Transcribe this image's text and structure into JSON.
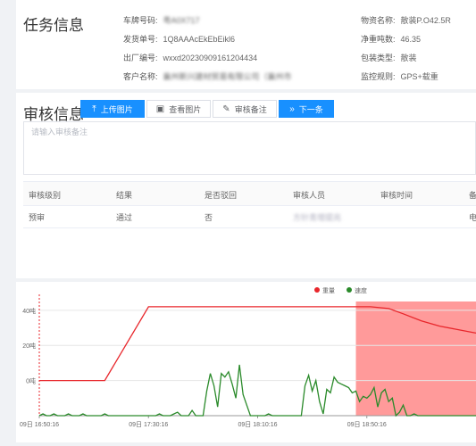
{
  "task": {
    "title": "任务信息",
    "fields": [
      {
        "label": "车牌号码:",
        "value": "粤A0X717",
        "blurred": true
      },
      {
        "label": "发货单号:",
        "value": "1Q8AAAcEkEbEikl6",
        "blurred": false
      },
      {
        "label": "出厂编号:",
        "value": "wxxd20230909161204434",
        "blurred": false
      },
      {
        "label": "客户名称:",
        "value": "襄州新兴建材贸易有限公司（襄州市",
        "blurred": true
      },
      {
        "label": "物资名称:",
        "value": "散装P.O42.5R",
        "blurred": false
      },
      {
        "label": "净重吨数:",
        "value": "46.35",
        "blurred": false
      },
      {
        "label": "包装类型:",
        "value": "散装",
        "blurred": false
      },
      {
        "label": "监控规则:",
        "value": "GPS+载重",
        "blurred": false
      }
    ]
  },
  "audit": {
    "title": "审核信息",
    "buttons": {
      "upload": "上传图片",
      "view": "查看图片",
      "remark": "审核备注",
      "next": "下一条"
    },
    "remark_placeholder": "请输入审核备注",
    "table": {
      "headers": [
        "审核级别",
        "结果",
        "是否驳回",
        "审核人员",
        "审核时间",
        "备"
      ],
      "rows": [
        [
          "预审",
          "通过",
          "否",
          "方针青增提兆",
          "",
          "电"
        ]
      ]
    }
  },
  "chart_data": {
    "type": "line",
    "legend": [
      "重量",
      "速度"
    ],
    "series_colors": [
      "#e8262b",
      "#2a8a2a"
    ],
    "highlight_color": "#ff9a9a",
    "y_ticks": [
      "40吨",
      "20吨",
      "0吨"
    ],
    "x_ticks": [
      "09日 16:50:16",
      "09日 17:30:16",
      "09日 18:10:16",
      "09日 18:50:16"
    ],
    "ylim": [
      -20,
      45
    ],
    "x_range": [
      0,
      120
    ],
    "marker_x": 0,
    "highlight_range": [
      87,
      120
    ],
    "weight": {
      "x": [
        0,
        18,
        30,
        31,
        87,
        91,
        96,
        100,
        105,
        110,
        115,
        120
      ],
      "y": [
        0,
        0,
        42,
        42,
        42,
        42,
        41,
        38,
        34,
        31,
        29,
        27
      ]
    },
    "speed": {
      "x": [
        0,
        1,
        2,
        3,
        4,
        5,
        6,
        7,
        8,
        9,
        10,
        11,
        12,
        13,
        14,
        15,
        16,
        17,
        18,
        19,
        20,
        21,
        22,
        23,
        24,
        25,
        26,
        27,
        28,
        29,
        30,
        31,
        32,
        33,
        34,
        35,
        36,
        37,
        38,
        39,
        40,
        41,
        42,
        43,
        44,
        45,
        46,
        47,
        48,
        49,
        50,
        51,
        52,
        53,
        54,
        55,
        56,
        57,
        58,
        59,
        60,
        61,
        62,
        63,
        64,
        65,
        66,
        67,
        68,
        69,
        70,
        71,
        72,
        73,
        74,
        75,
        76,
        77,
        78,
        79,
        80,
        81,
        82,
        83,
        84,
        85,
        86,
        87,
        88,
        89,
        90,
        91,
        92,
        93,
        94,
        95,
        96,
        97,
        98,
        99,
        100,
        101,
        102,
        103,
        104,
        105,
        106,
        107,
        108,
        109,
        110,
        111,
        112,
        113,
        114,
        115,
        116,
        117,
        118,
        119,
        120
      ],
      "y": [
        -20,
        -19,
        -20,
        -20,
        -19,
        -20,
        -20,
        -20,
        -19,
        -20,
        -20,
        -20,
        -19,
        -20,
        -20,
        -20,
        -20,
        -20,
        -19,
        -20,
        -20,
        -20,
        -20,
        -20,
        -20,
        -20,
        -20,
        -20,
        -20,
        -20,
        -20,
        -20,
        -20,
        -19,
        -20,
        -20,
        -20,
        -19,
        -18,
        -20,
        -20,
        -20,
        -17,
        -20,
        -20,
        -20,
        -6,
        4,
        -3,
        -15,
        4,
        2,
        5,
        -2,
        -10,
        9,
        -8,
        -14,
        -20,
        -20,
        -20,
        -20,
        -20,
        -19,
        -20,
        -20,
        -20,
        -20,
        -20,
        -20,
        -20,
        -20,
        -20,
        -3,
        3,
        -6,
        0,
        -12,
        -19,
        -5,
        -7,
        2,
        -1,
        -2,
        -3,
        -4,
        -7,
        -6,
        -12,
        -9,
        -10,
        -8,
        -4,
        -15,
        -7,
        -5,
        -12,
        -10,
        -20,
        -18,
        -14,
        -20,
        -20,
        -19,
        -20,
        -20,
        -20,
        -20,
        -20,
        -20,
        -20,
        -20,
        -20,
        -20,
        -20,
        -20,
        -20,
        -20,
        -20,
        -20,
        -20,
        -20,
        -20
      ]
    }
  }
}
